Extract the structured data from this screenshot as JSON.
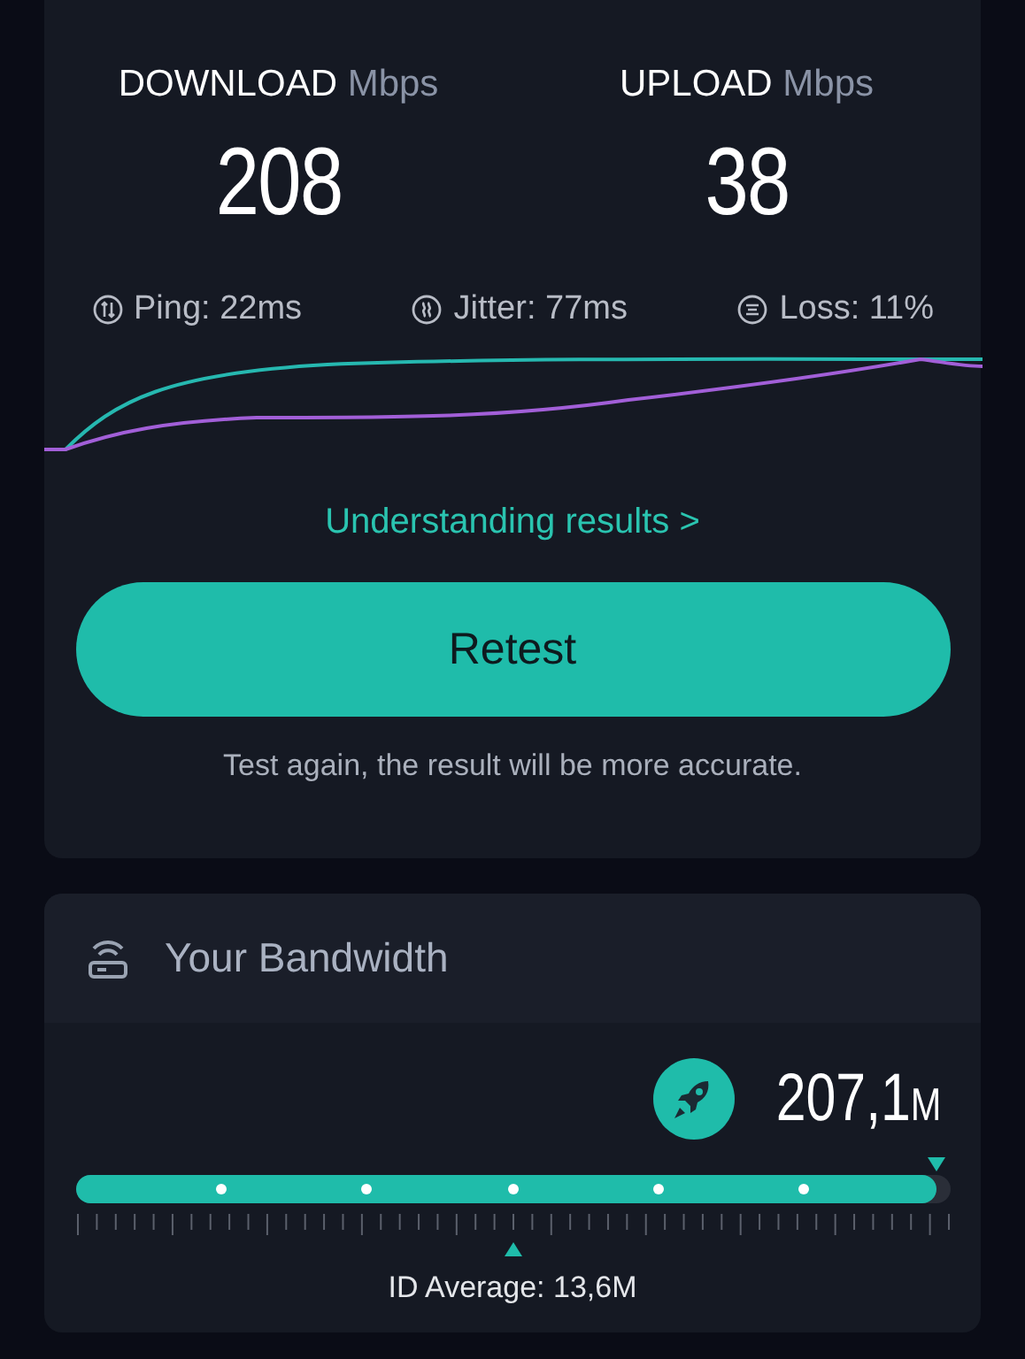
{
  "speeds": [
    {
      "label": "DOWNLOAD",
      "unit": "Mbps",
      "value": "208"
    },
    {
      "label": "UPLOAD",
      "unit": "Mbps",
      "value": "38"
    }
  ],
  "metrics": [
    {
      "kind": "ping",
      "text": "Ping: 22ms"
    },
    {
      "kind": "jitter",
      "text": "Jitter: 77ms"
    },
    {
      "kind": "loss",
      "text": "Loss: 11%"
    }
  ],
  "link": "Understanding results >",
  "retest_button": "Retest",
  "hint": "Test again, the result will be more accurate.",
  "bandwidth": {
    "title": "Your Bandwidth",
    "value": "207,1",
    "unit": "M",
    "level": 0.985,
    "average": "ID Average: 13,6M"
  }
}
